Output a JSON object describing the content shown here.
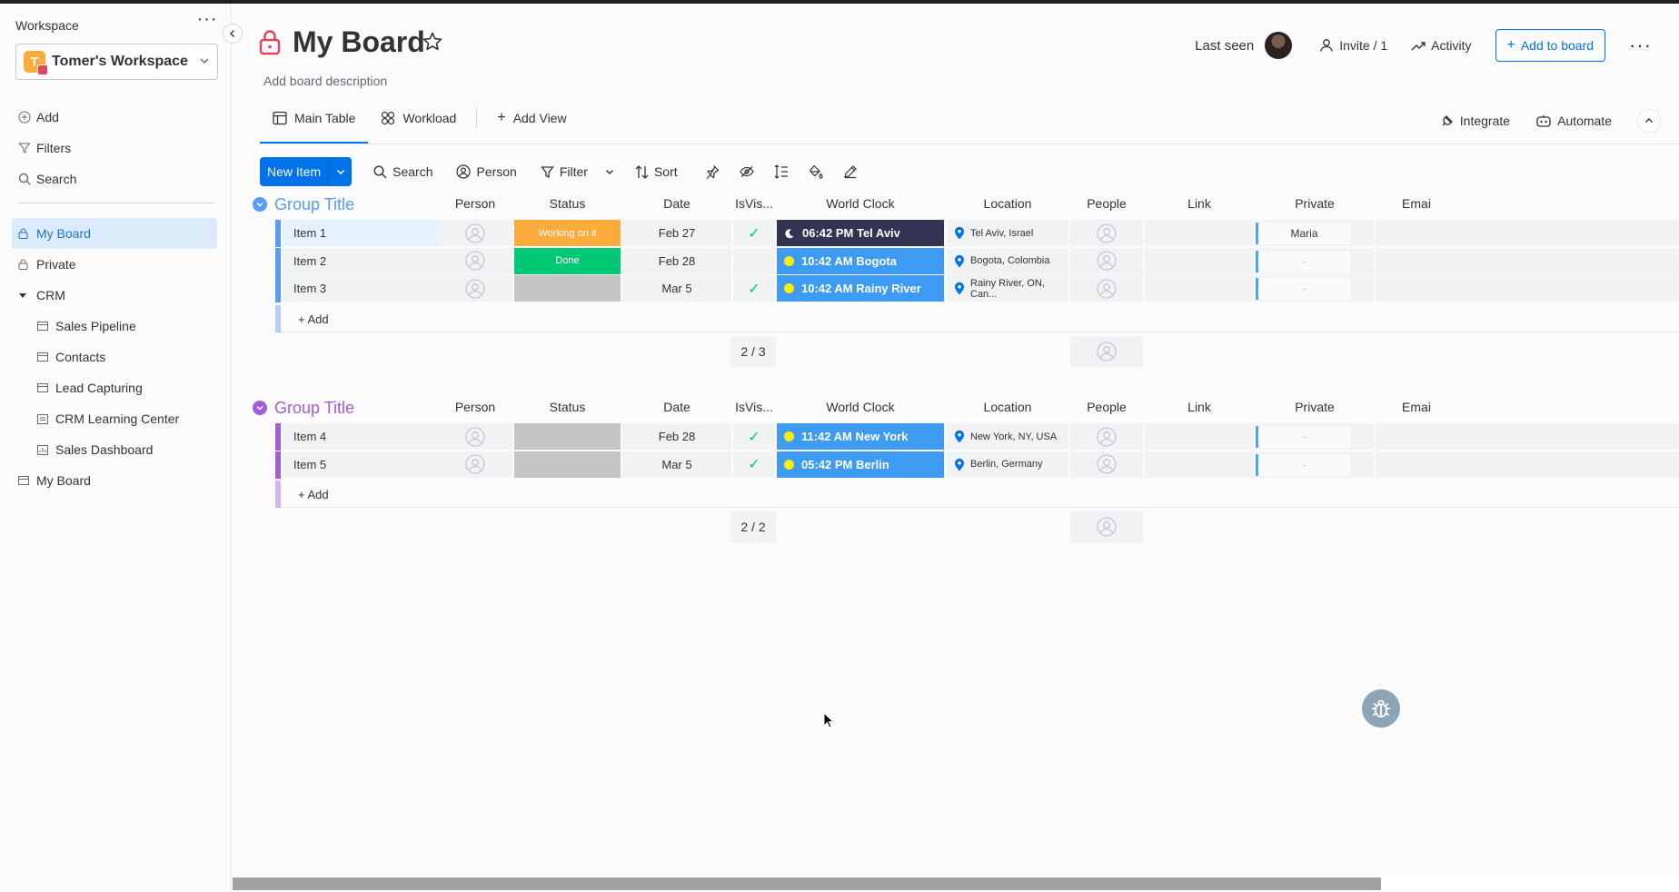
{
  "sidebar": {
    "workspace_label": "Workspace",
    "workspace_initial": "T",
    "workspace_name": "Tomer's Workspace",
    "actions": [
      {
        "label": "Add",
        "icon": "plus-circle-icon"
      },
      {
        "label": "Filters",
        "icon": "filter-icon"
      },
      {
        "label": "Search",
        "icon": "search-icon"
      }
    ],
    "items": [
      {
        "label": "My Board",
        "icon": "lock-icon",
        "active": true
      },
      {
        "label": "Private",
        "icon": "lock-icon"
      },
      {
        "label": "CRM",
        "icon": "caret-down-icon"
      },
      {
        "label": "Sales Pipeline",
        "icon": "board-icon"
      },
      {
        "label": "Contacts",
        "icon": "board-icon"
      },
      {
        "label": "Lead Capturing",
        "icon": "board-icon"
      },
      {
        "label": "CRM Learning Center",
        "icon": "doc-icon"
      },
      {
        "label": "Sales Dashboard",
        "icon": "dashboard-icon"
      },
      {
        "label": "My Board",
        "icon": "board-icon"
      }
    ]
  },
  "header": {
    "title": "My Board",
    "description": "Add board description",
    "last_seen": "Last seen",
    "invite": "Invite / 1",
    "activity": "Activity",
    "add_to_board": "Add to board"
  },
  "tabs": {
    "main_table": "Main Table",
    "workload": "Workload",
    "add_view": "Add View",
    "integrate": "Integrate",
    "automate": "Automate"
  },
  "toolbar": {
    "new_item": "New Item",
    "search": "Search",
    "person": "Person",
    "filter": "Filter",
    "sort": "Sort"
  },
  "columns": [
    "Person",
    "Status",
    "Date",
    "IsVis...",
    "World Clock",
    "Location",
    "People",
    "Link",
    "Private",
    "Emai"
  ],
  "groups": [
    {
      "title": "Group Title",
      "color": "#579bfc",
      "summary": "2 / 3",
      "add_label": "+ Add",
      "rows": [
        {
          "name": "Item 1",
          "status": "Working on it",
          "status_color": "#fdab3d",
          "date": "Feb 27",
          "visible": true,
          "clock": "06:42 PM Tel Aviv",
          "night": true,
          "location": "Tel Aviv, Israel",
          "private": "Maria"
        },
        {
          "name": "Item 2",
          "status": "Done",
          "status_color": "#00c875",
          "date": "Feb 28",
          "visible": false,
          "clock": "10:42 AM Bogota",
          "night": false,
          "location": "Bogota, Colombia",
          "private": "-"
        },
        {
          "name": "Item 3",
          "status": "",
          "status_color": "#c4c4c4",
          "date": "Mar 5",
          "visible": true,
          "clock": "10:42 AM Rainy River",
          "night": false,
          "location": "Rainy River, ON, Can...",
          "private": "-"
        }
      ]
    },
    {
      "title": "Group Title",
      "color": "#a25ddc",
      "summary": "2 / 2",
      "add_label": "+ Add",
      "rows": [
        {
          "name": "Item 4",
          "status": "",
          "status_color": "#c4c4c4",
          "date": "Feb 28",
          "visible": true,
          "clock": "11:42 AM New York",
          "night": false,
          "location": "New York, NY, USA",
          "private": "-"
        },
        {
          "name": "Item 5",
          "status": "",
          "status_color": "#c4c4c4",
          "date": "Mar 5",
          "visible": true,
          "clock": "05:42 PM Berlin",
          "night": false,
          "location": "Berlin, Germany",
          "private": "-"
        }
      ]
    }
  ],
  "colors": {
    "accent": "#0073ea",
    "clock_day": "#3d9bf4",
    "clock_night": "#333355"
  }
}
